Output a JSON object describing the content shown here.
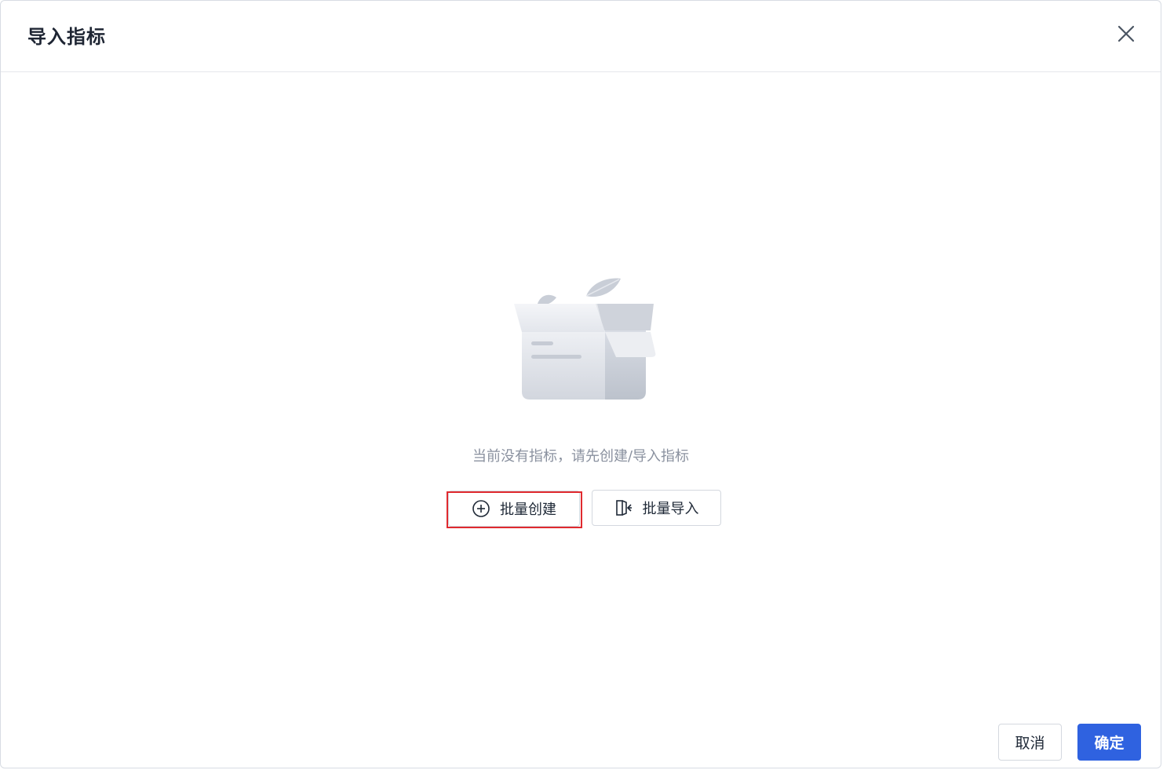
{
  "dialog": {
    "title": "导入指标"
  },
  "empty_state": {
    "message": "当前没有指标，请先创建/导入指标"
  },
  "actions": {
    "batch_create_label": "批量创建",
    "batch_import_label": "批量导入"
  },
  "footer": {
    "cancel_label": "取消",
    "confirm_label": "确定"
  },
  "colors": {
    "primary": "#2f62e0",
    "highlight": "#e02a2f",
    "muted_text": "#8a919f"
  },
  "icons": {
    "close": "close-icon",
    "batch_create": "plus-circle-icon",
    "batch_import": "import-icon",
    "empty": "empty-box-icon"
  }
}
